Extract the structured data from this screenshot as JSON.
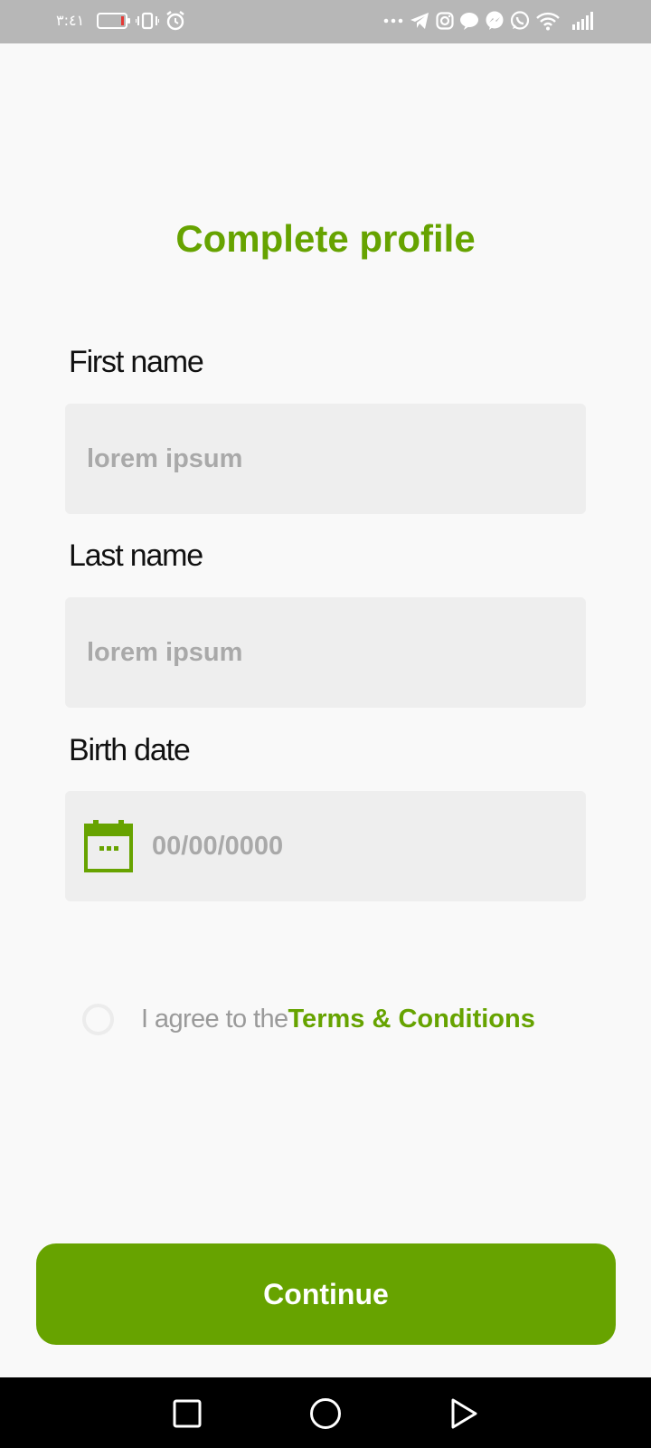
{
  "status_bar": {
    "time": "٣:٤١",
    "icons": [
      "battery-icon",
      "vibrate-icon",
      "alarm-icon",
      "more-dots-icon",
      "telegram-icon",
      "instagram-icon",
      "chat-icon",
      "messenger-icon",
      "whatsapp-icon",
      "wifi-icon",
      "signal-icon"
    ]
  },
  "title": "Complete profile",
  "form": {
    "first_name": {
      "label": "First name",
      "placeholder": "lorem ipsum"
    },
    "last_name": {
      "label": "Last name",
      "placeholder": "lorem ipsum"
    },
    "birth_date": {
      "label": "Birth date",
      "placeholder": "00/00/0000",
      "icon": "calendar-icon"
    }
  },
  "terms": {
    "prefix": "I agree to the",
    "link": "Terms & Conditions",
    "checked": false
  },
  "continue_label": "Continue",
  "nav": {
    "icons": [
      "recents-square-icon",
      "home-circle-icon",
      "back-triangle-icon"
    ]
  },
  "colors": {
    "accent": "#67a300",
    "field_bg": "#eeeeee",
    "page_bg": "#f9f9f9",
    "status_bar": "#b7b7b7"
  }
}
